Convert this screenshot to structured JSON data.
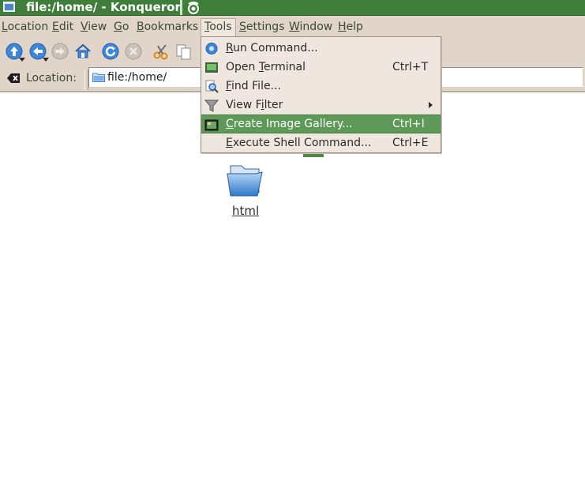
{
  "window": {
    "title": "file:/home/ - Konqueror",
    "app_icon": "konqueror-window-icon",
    "titlebar_color": "#3f7d3a"
  },
  "menubar": {
    "items": [
      {
        "label": "Location",
        "mnemonic": "L"
      },
      {
        "label": "Edit",
        "mnemonic": "E"
      },
      {
        "label": "View",
        "mnemonic": "V"
      },
      {
        "label": "Go",
        "mnemonic": "G"
      },
      {
        "label": "Bookmarks",
        "mnemonic": "B"
      },
      {
        "label": "Tools",
        "mnemonic": "T"
      },
      {
        "label": "Settings",
        "mnemonic": "S"
      },
      {
        "label": "Window",
        "mnemonic": "W"
      },
      {
        "label": "Help",
        "mnemonic": "H"
      }
    ],
    "active": "Tools"
  },
  "toolbar": {
    "buttons": [
      "up-icon",
      "back-icon",
      "forward-icon",
      "home-icon",
      "reload-icon",
      "stop-icon",
      "cut-icon",
      "copy-icon"
    ]
  },
  "location_bar": {
    "label": "Location:",
    "value": "file:/home/"
  },
  "tools_menu": {
    "items": [
      {
        "label": "Run Command...",
        "shortcut": "",
        "icon": "run-command-icon"
      },
      {
        "label": "Open Terminal",
        "shortcut": "Ctrl+T",
        "icon": "terminal-icon"
      },
      {
        "label": "Find File...",
        "shortcut": "",
        "icon": "find-file-icon"
      },
      {
        "label": "View Filter",
        "shortcut": "",
        "icon": "filter-icon",
        "submenu": true
      },
      {
        "label": "Create Image Gallery...",
        "shortcut": "Ctrl+I",
        "icon": "image-gallery-icon",
        "highlighted": true
      },
      {
        "label": "Execute Shell Command...",
        "shortcut": "Ctrl+E",
        "icon": ""
      }
    ],
    "highlight_color": "#5e9a57"
  },
  "content": {
    "items": [
      {
        "label": "html",
        "icon": "folder-icon"
      }
    ]
  }
}
